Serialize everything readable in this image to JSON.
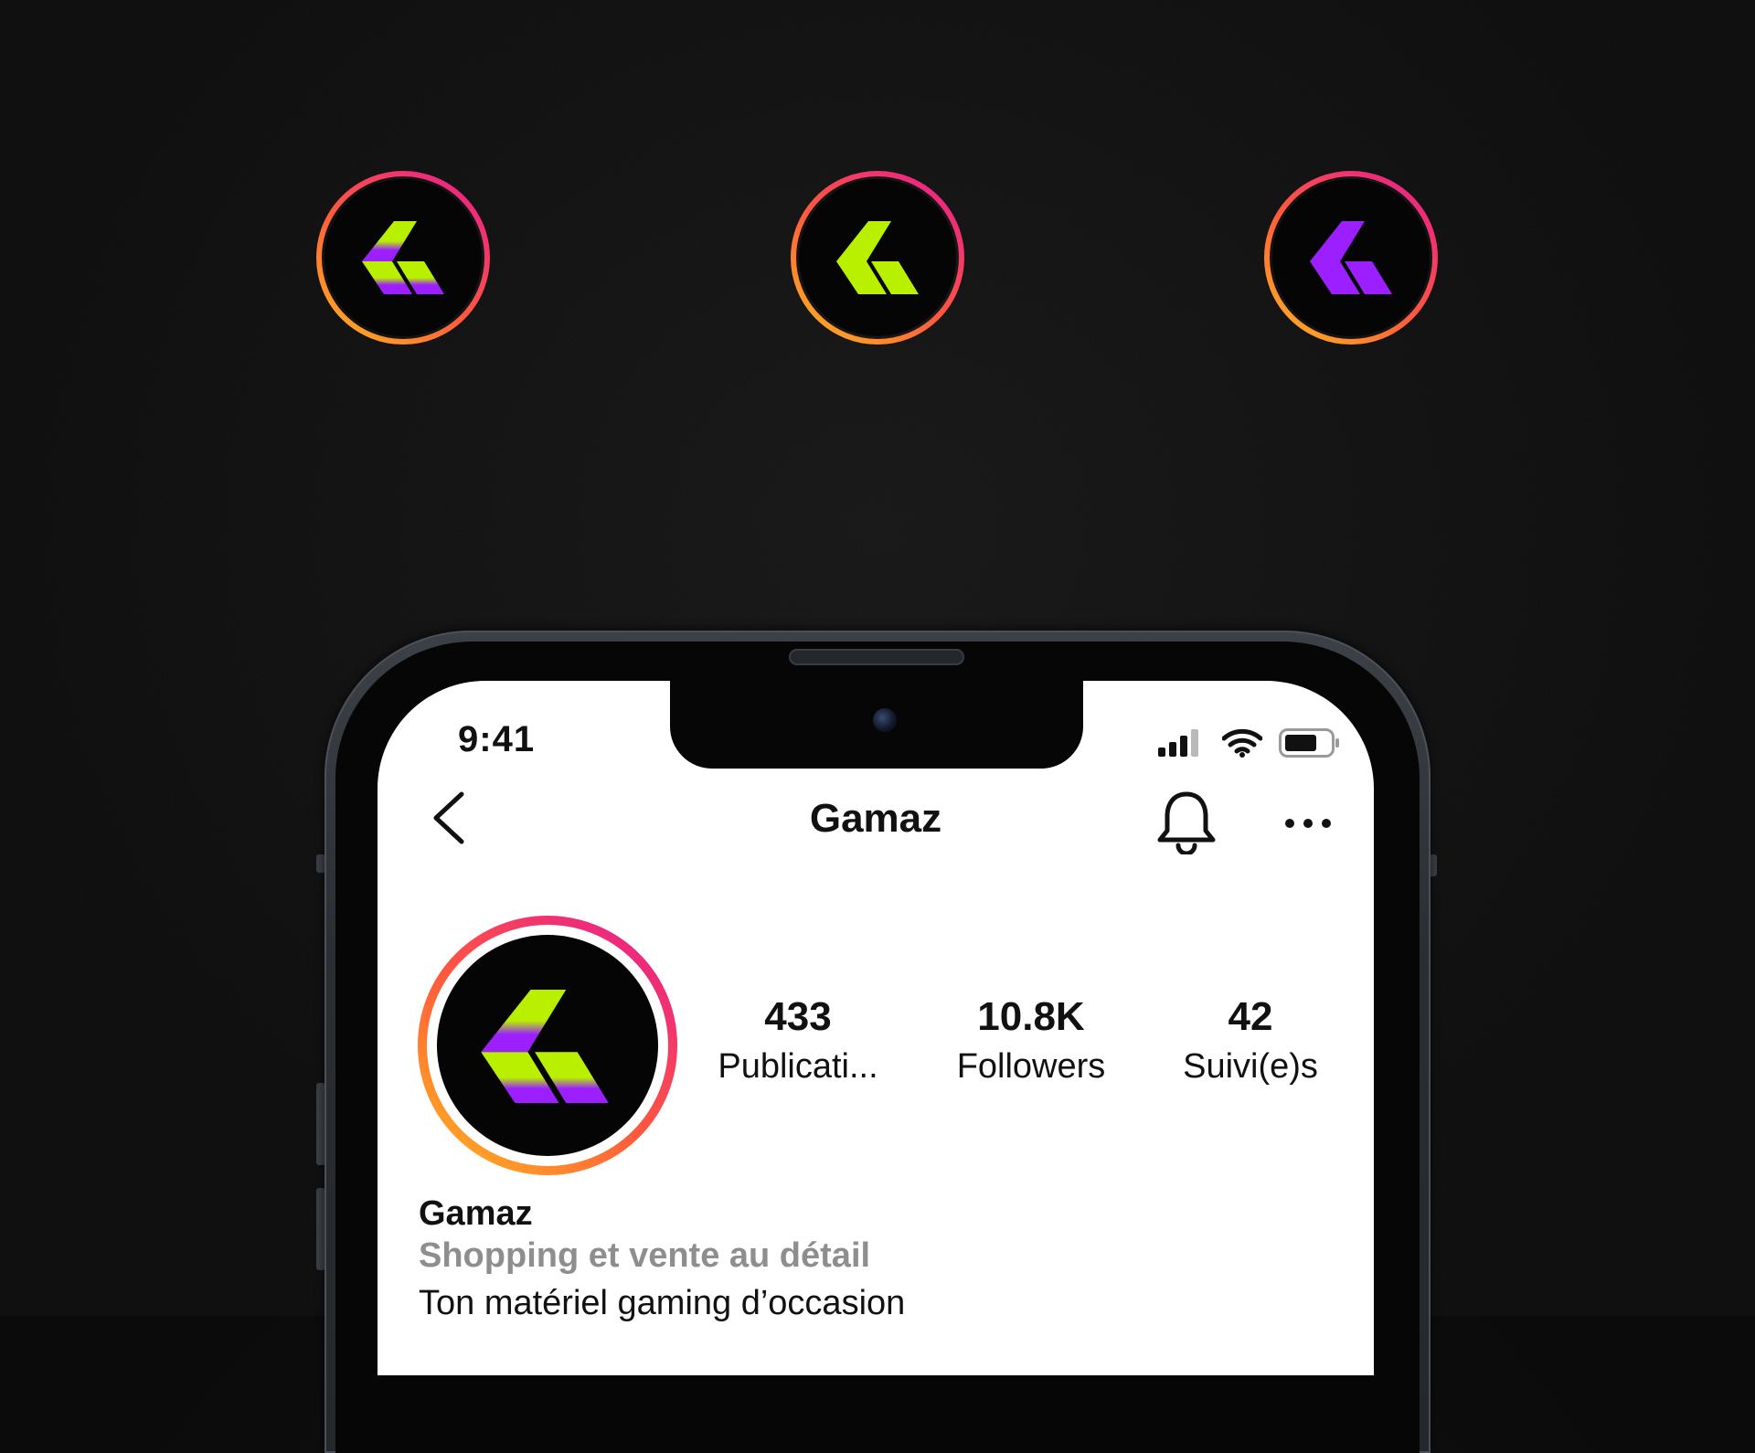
{
  "status_bar": {
    "time": "9:41"
  },
  "header": {
    "title": "Gamaz"
  },
  "profile": {
    "stats": [
      {
        "value": "433",
        "label": "Publicati..."
      },
      {
        "value": "10.8K",
        "label": "Followers"
      },
      {
        "value": "42",
        "label": "Suivi(e)s"
      }
    ],
    "name": "Gamaz",
    "category": "Shopping et vente au détail",
    "bio": "Ton matériel gaming d’occasion"
  },
  "icons": {
    "back": "chevron-left-icon",
    "bell": "bell-icon",
    "more": "more-horizontal-icon",
    "signal": "signal-icon",
    "wifi": "wifi-icon",
    "battery": "battery-icon"
  },
  "colors": {
    "ring_gradient": [
      "#e91e8c",
      "#ff5a3c",
      "#ffb020"
    ],
    "logo_green": "#b8f000",
    "logo_purple": "#9b1fff",
    "background": "#0c0c0c",
    "text_primary": "#111111",
    "text_secondary": "#8e8e8e"
  }
}
